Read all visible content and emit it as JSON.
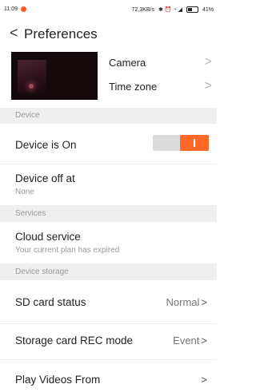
{
  "status_bar": {
    "time": "11:09",
    "network": "72,3KB/s",
    "battery": "41%"
  },
  "header": {
    "back_icon": "<",
    "title": "Preferences"
  },
  "camera_block": {
    "items": [
      {
        "label": "Camera",
        "chevron": ">"
      },
      {
        "label": "Time zone",
        "chevron": ">"
      }
    ]
  },
  "sections": {
    "device": "Device",
    "services": "Services",
    "storage": "Device storage"
  },
  "device": {
    "on_label": "Device is On",
    "on_state": true,
    "off_at_label": "Device off at",
    "off_at_value": "None"
  },
  "services": {
    "cloud_label": "Cloud service",
    "cloud_sub": "Your current plan has expired"
  },
  "storage": {
    "sd_label": "SD card status",
    "sd_value": "Normal",
    "rec_label": "Storage card REC mode",
    "rec_value": "Event",
    "play_label": "Play Videos From",
    "chevron": ">"
  },
  "colors": {
    "accent": "#ff6a2b",
    "section_bg": "#efefef",
    "muted_text": "#9a9a9a"
  }
}
